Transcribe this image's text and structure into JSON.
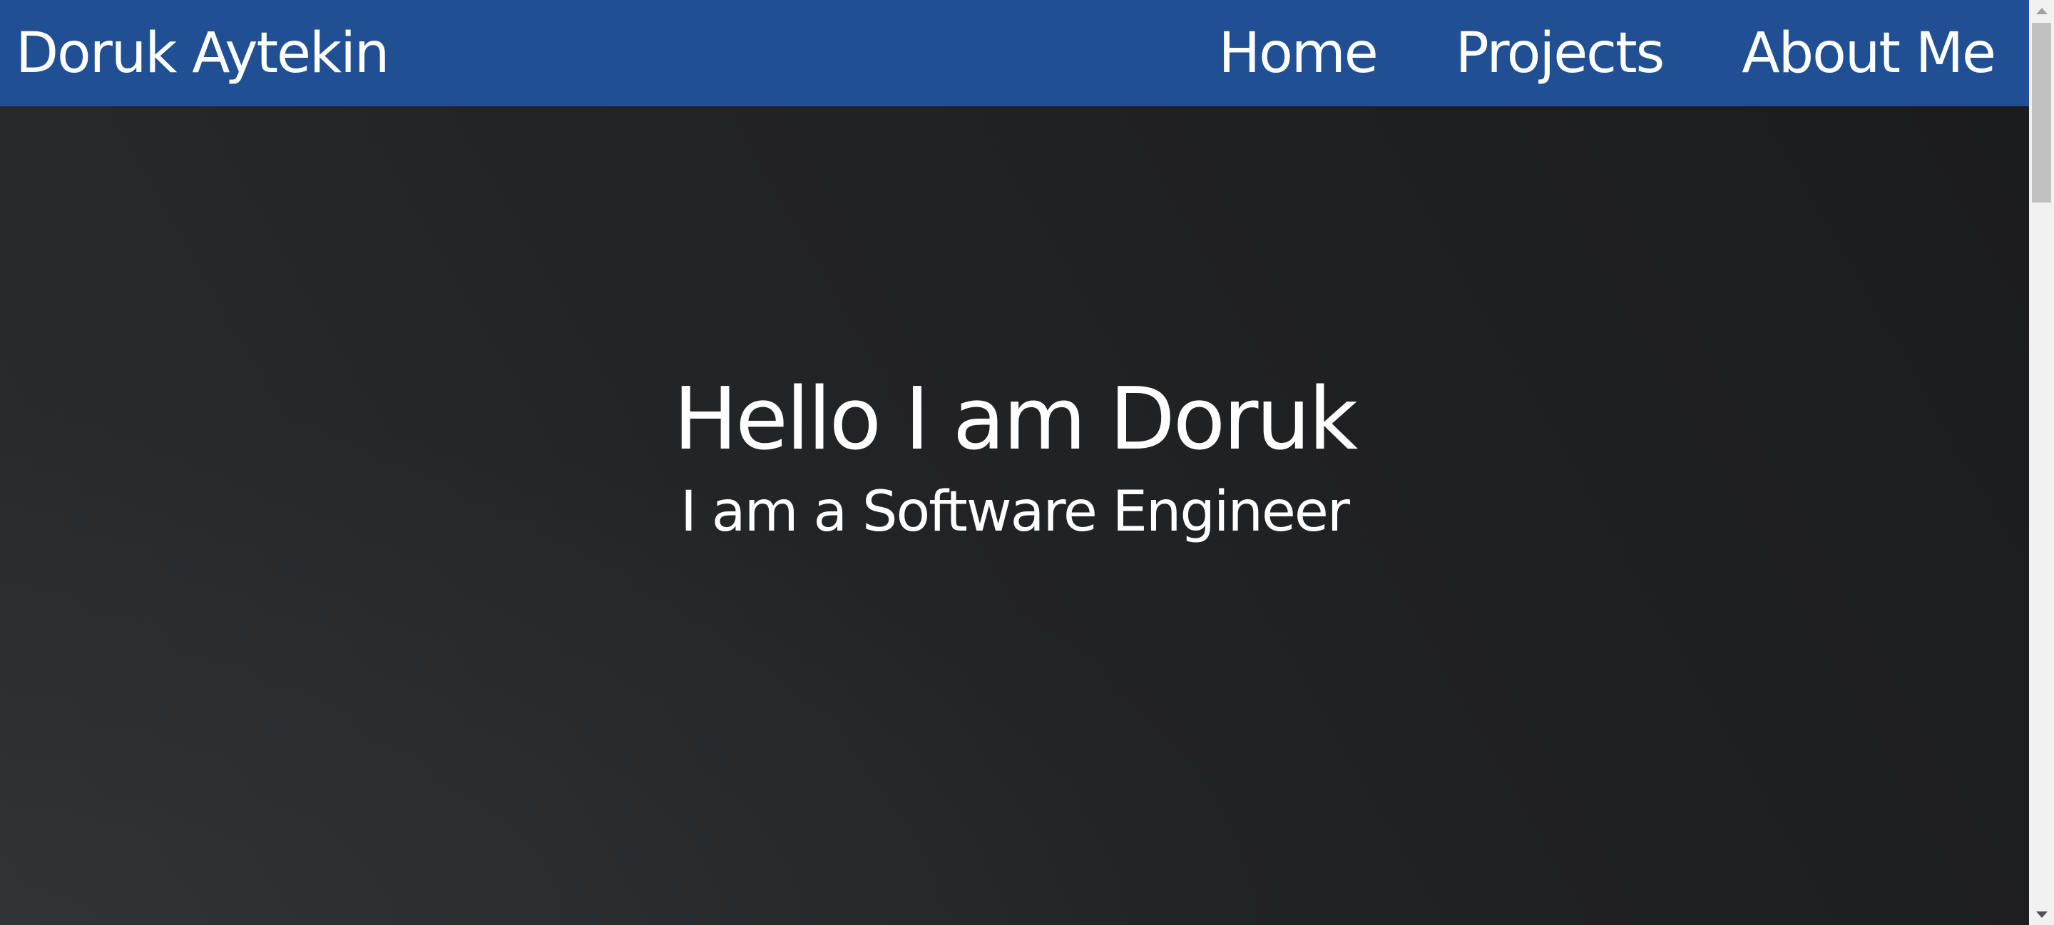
{
  "navbar": {
    "brand": "Doruk Aytekin",
    "links": [
      {
        "label": "Home"
      },
      {
        "label": "Projects"
      },
      {
        "label": "About Me"
      }
    ],
    "background_color": "#204f94"
  },
  "hero": {
    "title": "Hello I am Doruk",
    "subtitle": "I am a Software Engineer",
    "background_color": "#222325"
  },
  "icons": {
    "scroll_up": "scroll-up-arrow-icon",
    "scroll_down": "scroll-down-arrow-icon"
  }
}
